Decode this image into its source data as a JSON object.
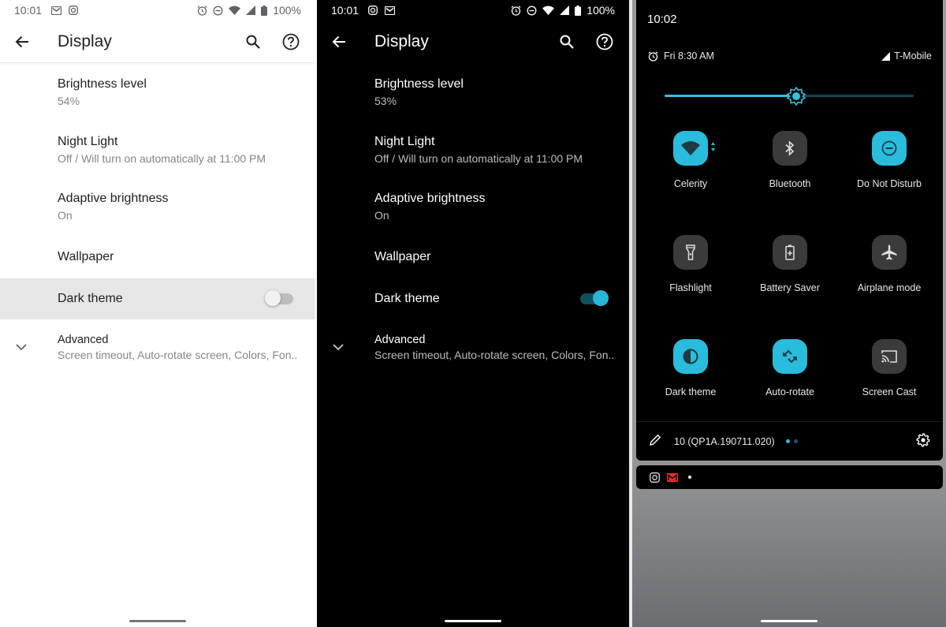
{
  "light_screen": {
    "status_bar": {
      "time": "10:01",
      "left_icons": [
        "gmail-icon",
        "instagram-icon"
      ],
      "right_icons": [
        "alarm-icon",
        "do-not-disturb-icon",
        "wifi-icon",
        "cell-signal-icon",
        "battery-icon"
      ],
      "battery": "100%"
    },
    "app_bar": {
      "title": "Display",
      "back_icon": "back-arrow-icon",
      "actions": [
        "search-icon",
        "help-icon"
      ]
    },
    "items": [
      {
        "title": "Brightness level",
        "subtitle": "54%"
      },
      {
        "title": "Night Light",
        "subtitle": "Off / Will turn on automatically at 11:00 PM"
      },
      {
        "title": "Adaptive brightness",
        "subtitle": "On"
      },
      {
        "title": "Wallpaper"
      },
      {
        "title": "Dark theme",
        "toggle_on": false
      },
      {
        "title": "Advanced",
        "subtitle": "Screen timeout, Auto-rotate screen, Colors, Fon.."
      }
    ]
  },
  "dark_screen": {
    "status_bar": {
      "time": "10:01",
      "left_icons": [
        "instagram-icon",
        "gmail-icon"
      ],
      "right_icons": [
        "alarm-icon",
        "do-not-disturb-icon",
        "wifi-icon",
        "cell-signal-icon",
        "battery-icon"
      ],
      "battery": "100%"
    },
    "app_bar": {
      "title": "Display",
      "back_icon": "back-arrow-icon",
      "actions": [
        "search-icon",
        "help-icon"
      ]
    },
    "items": [
      {
        "title": "Brightness level",
        "subtitle": "53%"
      },
      {
        "title": "Night Light",
        "subtitle": "Off / Will turn on automatically at 11:00 PM"
      },
      {
        "title": "Adaptive brightness",
        "subtitle": "On"
      },
      {
        "title": "Wallpaper"
      },
      {
        "title": "Dark theme",
        "toggle_on": true
      },
      {
        "title": "Advanced",
        "subtitle": "Screen timeout, Auto-rotate screen, Colors, Fon.."
      }
    ]
  },
  "quick_settings": {
    "clock": "10:02",
    "alarm": "Fri 8:30 AM",
    "carrier": "T-Mobile",
    "brightness_fraction": 0.53,
    "tiles": [
      {
        "label": "Celerity",
        "icon": "wifi-icon",
        "on": true
      },
      {
        "label": "Bluetooth",
        "icon": "bluetooth-icon",
        "on": false
      },
      {
        "label": "Do Not Disturb",
        "icon": "do-not-disturb-icon",
        "on": true
      },
      {
        "label": "Flashlight",
        "icon": "flashlight-icon",
        "on": false
      },
      {
        "label": "Battery Saver",
        "icon": "battery-saver-icon",
        "on": false
      },
      {
        "label": "Airplane mode",
        "icon": "airplane-icon",
        "on": false
      },
      {
        "label": "Dark theme",
        "icon": "dark-theme-icon",
        "on": true
      },
      {
        "label": "Auto-rotate",
        "icon": "auto-rotate-icon",
        "on": true
      },
      {
        "label": "Screen Cast",
        "icon": "screen-cast-icon",
        "on": false
      }
    ],
    "build": "10 (QP1A.190711.020)",
    "page_count": 2,
    "current_page": 1,
    "notification_icons": [
      "instagram-icon",
      "gmail-icon"
    ]
  },
  "colors": {
    "accent": "#29bcdc",
    "tile_off": "#3b3b3b",
    "light_selected_row": "#e6e6e6",
    "gmail_red": "#d93025"
  }
}
